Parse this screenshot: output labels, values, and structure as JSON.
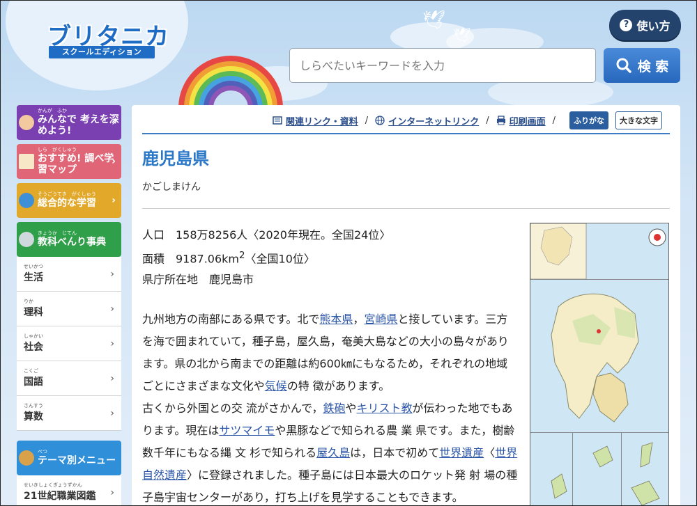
{
  "header": {
    "logo_title": "ブリタニカ",
    "logo_subtitle": "スクールエディション",
    "help_label": "使い方",
    "search_placeholder": "しらべたいキーワードを入力",
    "search_button_label": "検 索"
  },
  "sidebar": {
    "cards": [
      {
        "ruby": "かんが　ふか",
        "label": "みんなで 考えを深めよう!"
      },
      {
        "ruby": "しら　がくしゅう",
        "label": "おすすめ! 調べ学習マップ"
      },
      {
        "ruby": "そうごうてき　がくしゅう",
        "label": "総合的な学習"
      },
      {
        "ruby": "きょうか　じてん",
        "label": "教科べんり事典"
      }
    ],
    "subjects": [
      {
        "ruby": "せいかつ",
        "label": "生活"
      },
      {
        "ruby": "りか",
        "label": "理科"
      },
      {
        "ruby": "しゃかい",
        "label": "社会"
      },
      {
        "ruby": "こくご",
        "label": "国語"
      },
      {
        "ruby": "さんすう",
        "label": "算数"
      }
    ],
    "theme_menu": {
      "ruby": "べつ",
      "label": "テーマ別メニュー"
    },
    "theme_items": [
      {
        "ruby": "せいきしょくぎょうずかん",
        "label": "21世紀職業図鑑"
      }
    ]
  },
  "toolbar": {
    "related_link": "関連リンク・資料",
    "internet_link": "インターネットリンク",
    "print_link": "印刷画面",
    "furigana_button": "ふりがな",
    "large_text_button": "大きな文字"
  },
  "article": {
    "title": "鹿児島県",
    "reading": "かごしまけん",
    "population": "人口　158万8256人〈2020年現在。全国24位〉",
    "area_prefix": "面積　9187.06km",
    "area_sup": "2",
    "area_suffix": "〈全国10位〉",
    "capital": "県庁所在地　鹿児島市",
    "p1_a": "九州地方の南部にある県です。北で",
    "link_kumamoto": "熊本県",
    "p1_b": "，",
    "link_miyazaki": "宮崎県",
    "p1_c": "と接しています。三方を海で囲まれていて，種子島，屋久島，奄美大島などの大小の島々があります。県の北から南までの距離は約600㎞にもなるため，それぞれの地域ごとにさまざまな文化や",
    "link_kikou": "気候",
    "p1_d": "の特 徴があります。",
    "p2_a": "古くから外国との交 流がさかんで，",
    "link_teppou": "鉄砲",
    "p2_b": "や",
    "link_christ": "キリスト教",
    "p2_c": "が伝わった地でもあります。現在は",
    "link_satsuma": "サツマイモ",
    "p2_d": "や黒豚などで知られる農 業 県です。また，樹齢数千年にもなる縄 文 杉で知られる",
    "link_yakushima": "屋久島",
    "p2_e": "は，日本で初めて",
    "link_isan": "世界遺産",
    "p2_f": "〈",
    "link_shizen": "世界自然遺産",
    "p2_g": "〉に登録されました。種子島には日本最大のロケット発 射 場の種子島宇宙センターがあり，打ち上げを見学することもできます。"
  }
}
